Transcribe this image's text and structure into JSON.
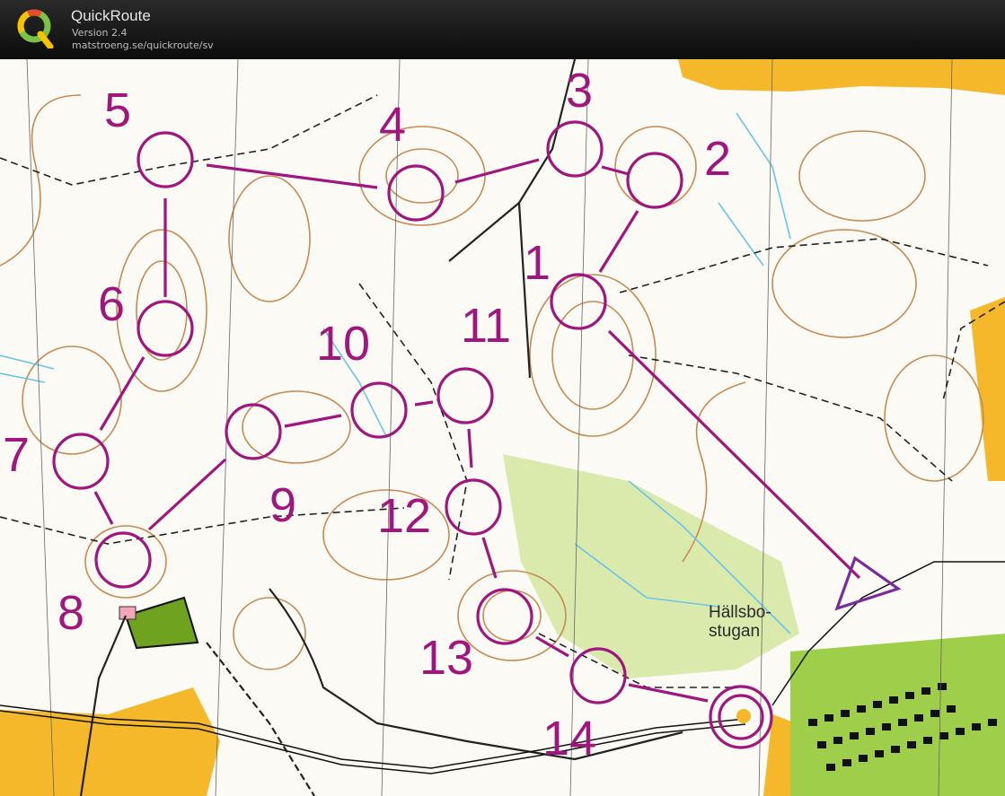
{
  "app": {
    "title": "QuickRoute",
    "version": "Version 2.4",
    "url": "matstroeng.se/quickroute/sv",
    "logo_letter": "Q"
  },
  "colors": {
    "course": "#a0157e",
    "contour": "#c78a52",
    "water": "#6cc3e8",
    "open_land": "#f4b82a",
    "vegetation": "#c9df8a",
    "path": "#222222"
  },
  "map": {
    "place_label_line1": "Hällsbo-",
    "place_label_line2": "stugan",
    "controls": [
      {
        "label": "1"
      },
      {
        "label": "2"
      },
      {
        "label": "3"
      },
      {
        "label": "4"
      },
      {
        "label": "5"
      },
      {
        "label": "6"
      },
      {
        "label": "7"
      },
      {
        "label": "8"
      },
      {
        "label": "9"
      },
      {
        "label": "10"
      },
      {
        "label": "11"
      },
      {
        "label": "12"
      },
      {
        "label": "13"
      },
      {
        "label": "14"
      }
    ]
  }
}
